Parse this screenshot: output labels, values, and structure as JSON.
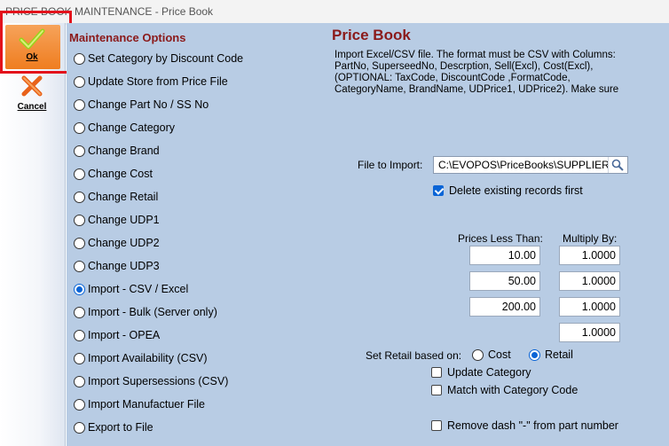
{
  "window": {
    "title": "PRICE BOOK MAINTENANCE - Price Book"
  },
  "toolbar": {
    "ok_label": "Ok",
    "cancel_label": "Cancel"
  },
  "options": {
    "title": "Maintenance Options",
    "items": [
      {
        "label": "Set Category by Discount Code",
        "selected": false
      },
      {
        "label": "Update Store from Price File",
        "selected": false
      },
      {
        "label": "Change Part No / SS No",
        "selected": false
      },
      {
        "label": "Change Category",
        "selected": false
      },
      {
        "label": "Change Brand",
        "selected": false
      },
      {
        "label": "Change Cost",
        "selected": false
      },
      {
        "label": "Change Retail",
        "selected": false
      },
      {
        "label": "Change UDP1",
        "selected": false
      },
      {
        "label": "Change UDP2",
        "selected": false
      },
      {
        "label": "Change UDP3",
        "selected": false
      },
      {
        "label": "Import - CSV / Excel",
        "selected": true
      },
      {
        "label": "Import - Bulk (Server only)",
        "selected": false
      },
      {
        "label": "Import - OPEA",
        "selected": false
      },
      {
        "label": "Import Availability (CSV)",
        "selected": false
      },
      {
        "label": "Import Supersessions (CSV)",
        "selected": false
      },
      {
        "label": "Import Manufactuer File",
        "selected": false
      },
      {
        "label": "Export to File",
        "selected": false
      }
    ]
  },
  "pricebook": {
    "title": "Price Book",
    "description_lines": [
      "Import Excel/CSV file. The format must be CSV with Columns:",
      "PartNo, SuperseedNo, Descrption, Sell(Excl), Cost(Excl),",
      "(OPTIONAL: TaxCode, DiscountCode ,FormatCode,",
      "CategoryName, BrandName, UDPrice1, UDPrice2). Make sure"
    ],
    "file_label": "File to Import:",
    "file_value": "C:\\EVOPOS\\PriceBooks\\SUPPLIER",
    "delete_existing_label": "Delete existing records first",
    "delete_existing_checked": true,
    "prices_less_than_header": "Prices Less Than:",
    "multiply_by_header": "Multiply By:",
    "price_rows": [
      {
        "less_than": "10.00",
        "multiply": "1.0000"
      },
      {
        "less_than": "50.00",
        "multiply": "1.0000"
      },
      {
        "less_than": "200.00",
        "multiply": "1.0000"
      },
      {
        "less_than": "",
        "multiply": "1.0000"
      }
    ],
    "set_retail_label": "Set Retail based on:",
    "retail_basis_options": [
      "Cost",
      "Retail"
    ],
    "retail_basis_selected": "Retail",
    "update_category_label": "Update Category",
    "update_category_checked": false,
    "match_category_label": "Match with Category Code",
    "match_category_checked": false,
    "remove_dash_label": "Remove dash \"-\" from part number",
    "remove_dash_checked": false
  },
  "colors": {
    "panel_bg": "#b8cce4",
    "title_red": "#8b1a1a",
    "accent_blue": "#0a64d6",
    "ok_orange": "#ef7d20",
    "focus_red": "#e3121b"
  },
  "icons": {
    "ok": "checkmark-icon",
    "cancel": "x-cross-icon",
    "search": "magnifier-icon"
  }
}
